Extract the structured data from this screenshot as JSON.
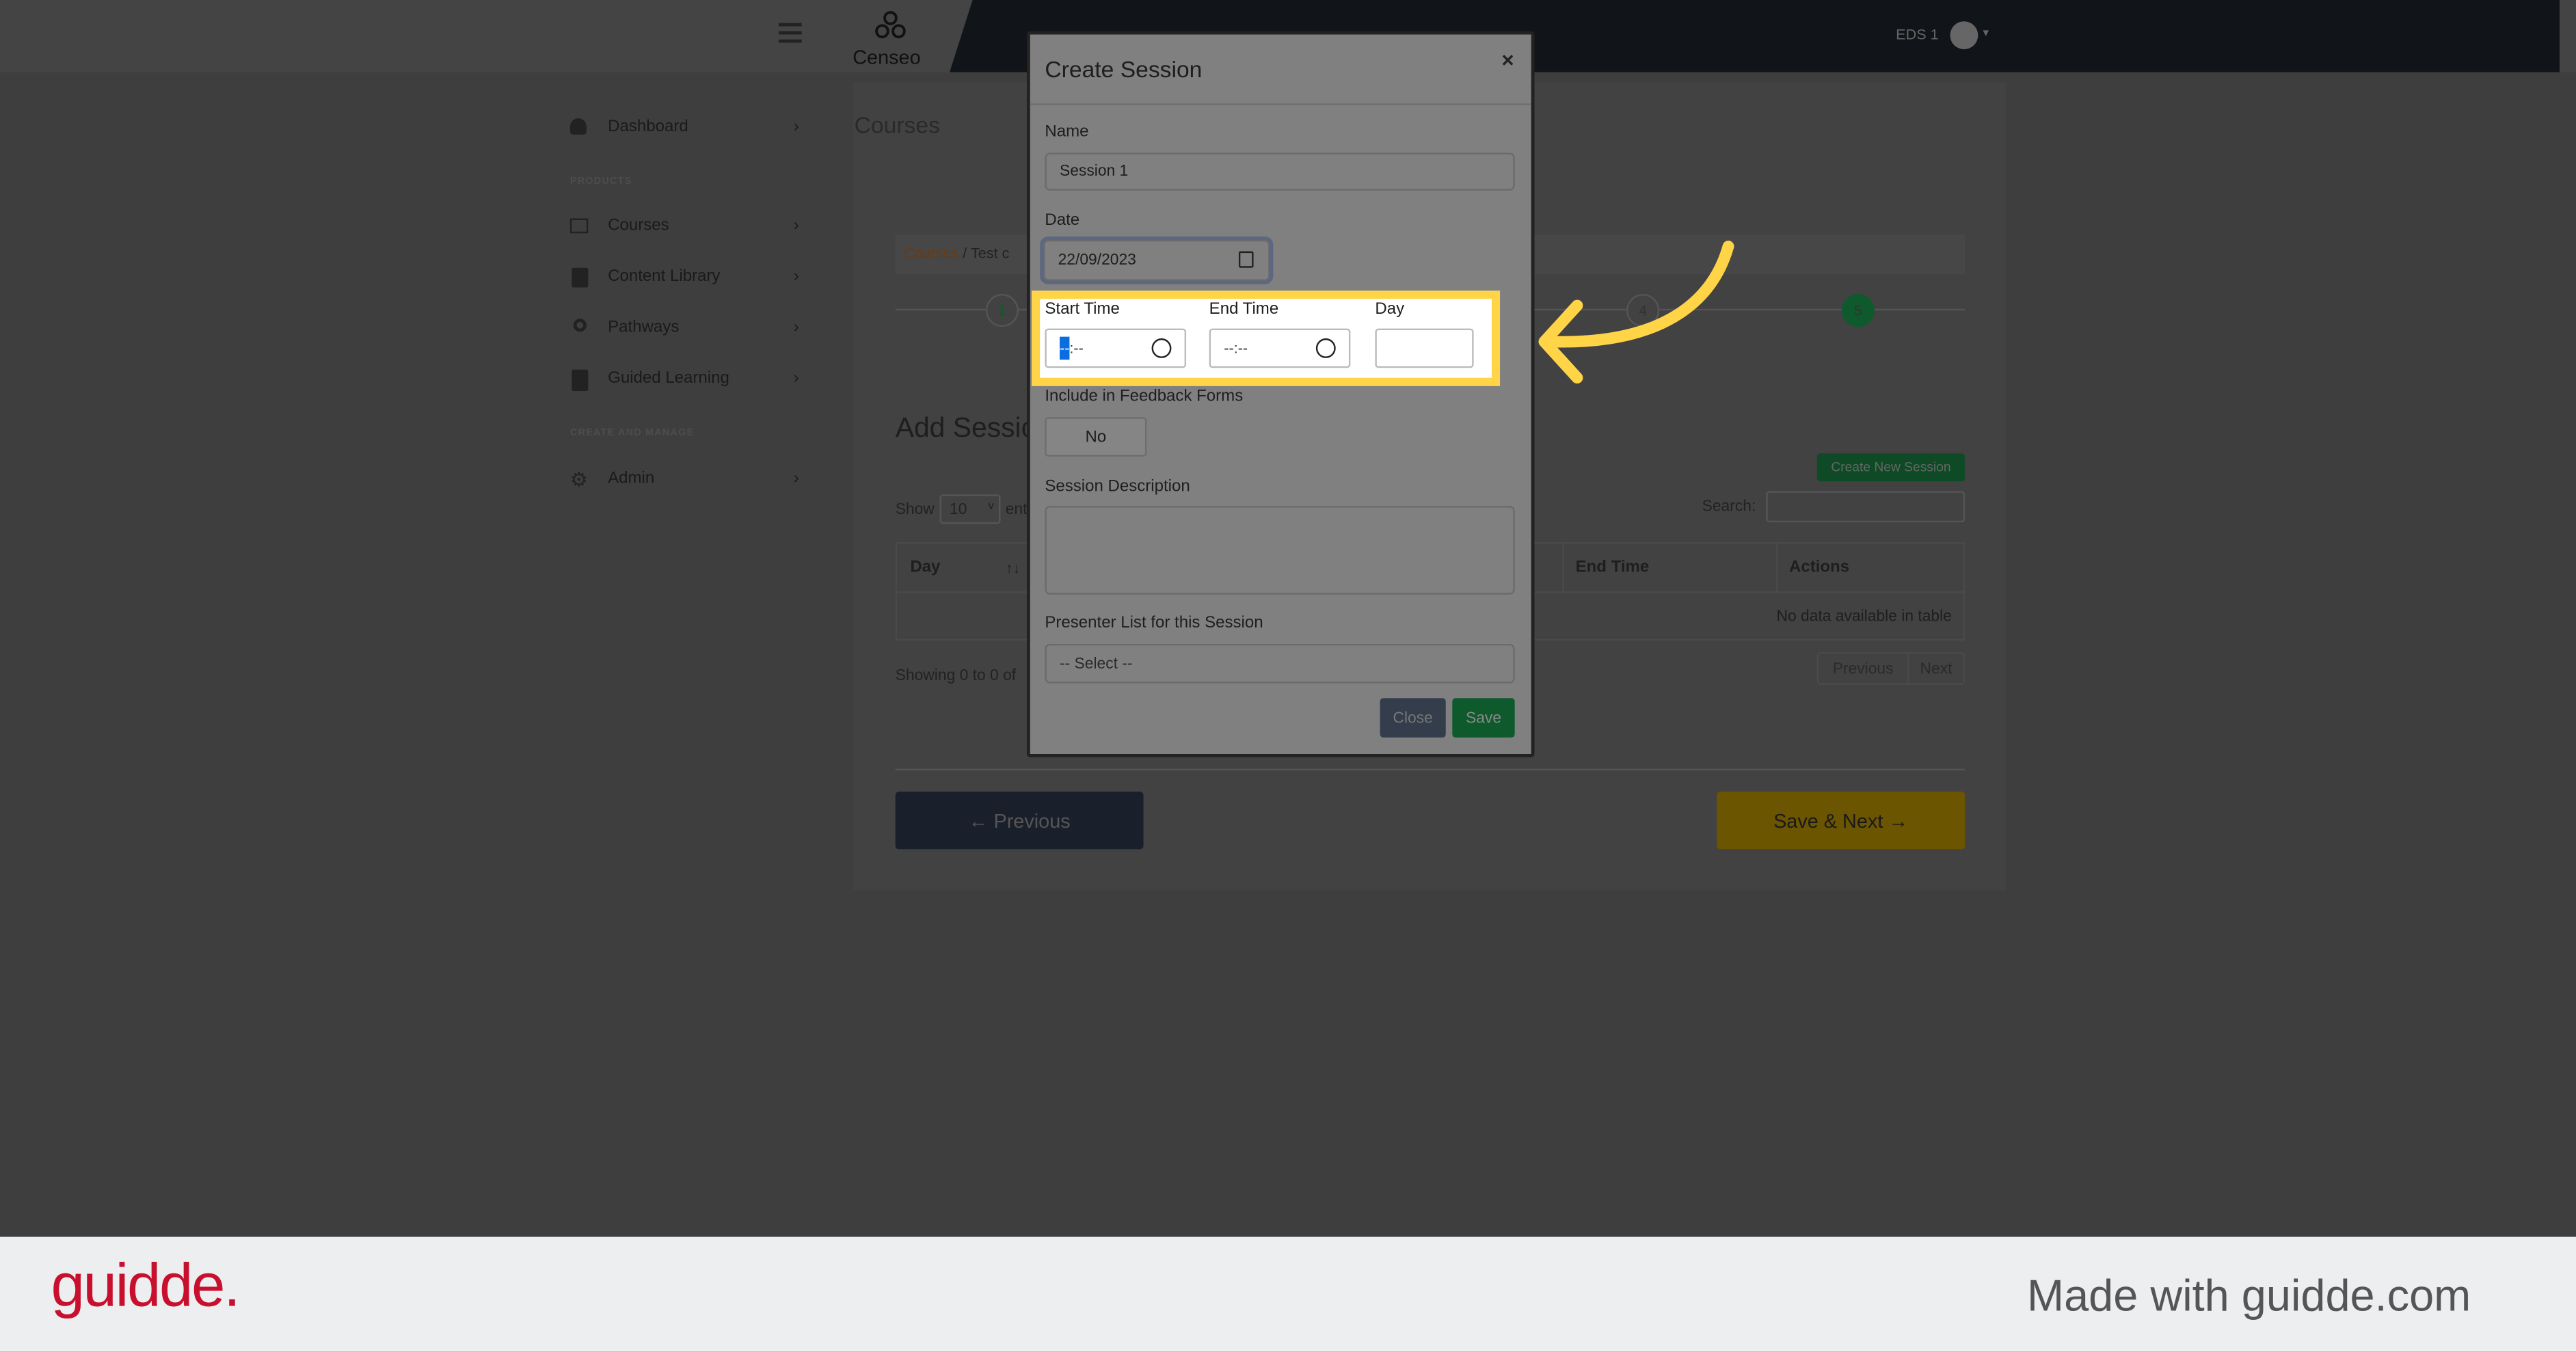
{
  "header": {
    "brand": "Censeo",
    "user": "EDS 1",
    "icons": [
      "hamburger-icon",
      "censeo-logo",
      "avatar-icon",
      "caret-down-icon"
    ]
  },
  "sidebar": {
    "items": [
      {
        "label": "Dashboard",
        "icon": "dashboard-icon"
      },
      {
        "section": "PRODUCTS"
      },
      {
        "label": "Courses",
        "icon": "courses-icon"
      },
      {
        "label": "Content Library",
        "icon": "book-icon"
      },
      {
        "label": "Pathways",
        "icon": "award-icon"
      },
      {
        "label": "Guided Learning",
        "icon": "clipboard-icon"
      },
      {
        "section": "CREATE AND MANAGE"
      },
      {
        "label": "Admin",
        "icon": "gear-icon"
      }
    ]
  },
  "main": {
    "title": "Courses",
    "breadcrumb": {
      "link": "Courses",
      "sep": "/",
      "current": "Test c"
    },
    "steps": [
      "1",
      "4",
      "5"
    ],
    "section_title": "Add Sessio",
    "create_button": "Create New Session",
    "show_label": "Show",
    "show_value": "10",
    "entries_label": "ent",
    "search_label": "Search:",
    "table": {
      "headers": [
        "Day",
        "End Time",
        "Actions"
      ],
      "empty": "No data available in table"
    },
    "showing": "Showing 0 to 0 of",
    "pager": {
      "prev": "Previous",
      "next": "Next"
    },
    "prev_button": "Previous",
    "next_button": "Save & Next"
  },
  "modal": {
    "title": "Create Session",
    "close_glyph": "×",
    "name_label": "Name",
    "name_value": "Session 1",
    "date_label": "Date",
    "date_value": "22/09/2023",
    "start_label": "Start Time",
    "start_value_sel": "--",
    "start_value_rest": ":--",
    "end_label": "End Time",
    "end_value": "--:--",
    "day_label": "Day",
    "day_value": "",
    "feedback_label": "Include in Feedback Forms",
    "feedback_value": "No",
    "desc_label": "Session Description",
    "presenter_label": "Presenter List for this Session",
    "presenter_value": "-- Select --",
    "close_button": "Close",
    "save_button": "Save"
  },
  "footer": {
    "brand": "guidde.",
    "tagline": "Made with guidde.com"
  },
  "colors": {
    "highlight": "#ffd447",
    "green": "#0e5a2c",
    "brand_red": "#c8102e",
    "navy": "#1a202b"
  }
}
